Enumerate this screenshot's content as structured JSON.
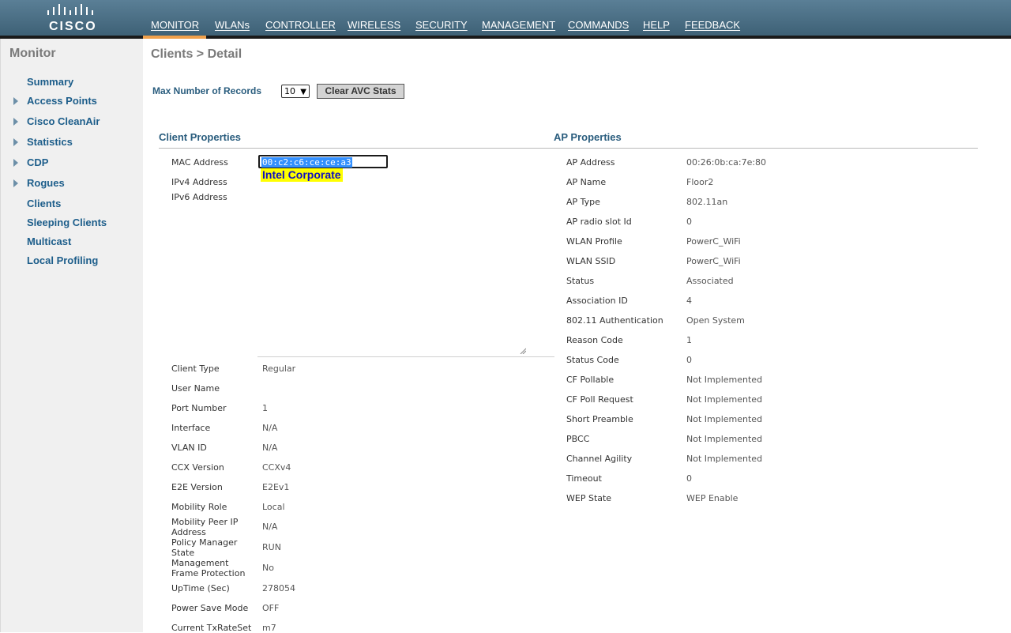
{
  "brand": {
    "logo_text": "CISCO"
  },
  "nav": {
    "items": [
      "MONITOR",
      "WLANs",
      "CONTROLLER",
      "WIRELESS",
      "SECURITY",
      "MANAGEMENT",
      "COMMANDS",
      "HELP",
      "FEEDBACK"
    ],
    "active": "MONITOR"
  },
  "sidebar": {
    "title": "Monitor",
    "items": [
      {
        "label": "Summary",
        "expandable": false
      },
      {
        "label": "Access Points",
        "expandable": true
      },
      {
        "label": "Cisco CleanAir",
        "expandable": true
      },
      {
        "label": "Statistics",
        "expandable": true
      },
      {
        "label": "CDP",
        "expandable": true
      },
      {
        "label": "Rogues",
        "expandable": true
      },
      {
        "label": "Clients",
        "expandable": false
      },
      {
        "label": "Sleeping Clients",
        "expandable": false
      },
      {
        "label": "Multicast",
        "expandable": false
      },
      {
        "label": "Local Profiling",
        "expandable": false
      }
    ]
  },
  "page": {
    "breadcrumb": "Clients > Detail",
    "max_records_label": "Max Number of Records",
    "max_records_value": "10",
    "clear_avc_button": "Clear AVC Stats"
  },
  "client_properties": {
    "title": "Client Properties",
    "mac_label": "MAC Address",
    "mac_value": "00:c2:c6:ce:ce:a3",
    "vendor_tooltip": "Intel Corporate",
    "ipv4_label": "IPv4 Address",
    "ipv6_label": "IPv6 Address",
    "rows": [
      {
        "label": "Client Type",
        "value": "Regular"
      },
      {
        "label": "User Name",
        "value": ""
      },
      {
        "label": "Port Number",
        "value": "1"
      },
      {
        "label": "Interface",
        "value": "N/A"
      },
      {
        "label": "VLAN ID",
        "value": "N/A"
      },
      {
        "label": "CCX Version",
        "value": "CCXv4"
      },
      {
        "label": "E2E Version",
        "value": "E2Ev1"
      },
      {
        "label": "Mobility Role",
        "value": "Local"
      },
      {
        "label": "Mobility Peer IP Address",
        "value": "N/A"
      },
      {
        "label": "Policy Manager State",
        "value": "RUN"
      },
      {
        "label": "Management Frame Protection",
        "value": "No"
      },
      {
        "label": "UpTime (Sec)",
        "value": "278054"
      },
      {
        "label": "Power Save Mode",
        "value": "OFF"
      },
      {
        "label": "Current TxRateSet",
        "value": "m7"
      }
    ]
  },
  "ap_properties": {
    "title": "AP Properties",
    "rows": [
      {
        "label": "AP Address",
        "value": "00:26:0b:ca:7e:80"
      },
      {
        "label": "AP Name",
        "value": "Floor2"
      },
      {
        "label": "AP Type",
        "value": "802.11an"
      },
      {
        "label": "AP radio slot Id",
        "value": "0"
      },
      {
        "label": "WLAN Profile",
        "value": "PowerC_WiFi"
      },
      {
        "label": "WLAN SSID",
        "value": "PowerC_WiFi"
      },
      {
        "label": "Status",
        "value": "Associated"
      },
      {
        "label": "Association ID",
        "value": "4"
      },
      {
        "label": "802.11 Authentication",
        "value": "Open System"
      },
      {
        "label": "Reason Code",
        "value": "1"
      },
      {
        "label": "Status Code",
        "value": "0"
      },
      {
        "label": "CF Pollable",
        "value": "Not Implemented"
      },
      {
        "label": "CF Poll Request",
        "value": "Not Implemented"
      },
      {
        "label": "Short Preamble",
        "value": "Not Implemented"
      },
      {
        "label": "PBCC",
        "value": "Not Implemented"
      },
      {
        "label": "Channel Agility",
        "value": "Not Implemented"
      },
      {
        "label": "Timeout",
        "value": "0"
      },
      {
        "label": "WEP State",
        "value": "WEP Enable"
      }
    ]
  }
}
